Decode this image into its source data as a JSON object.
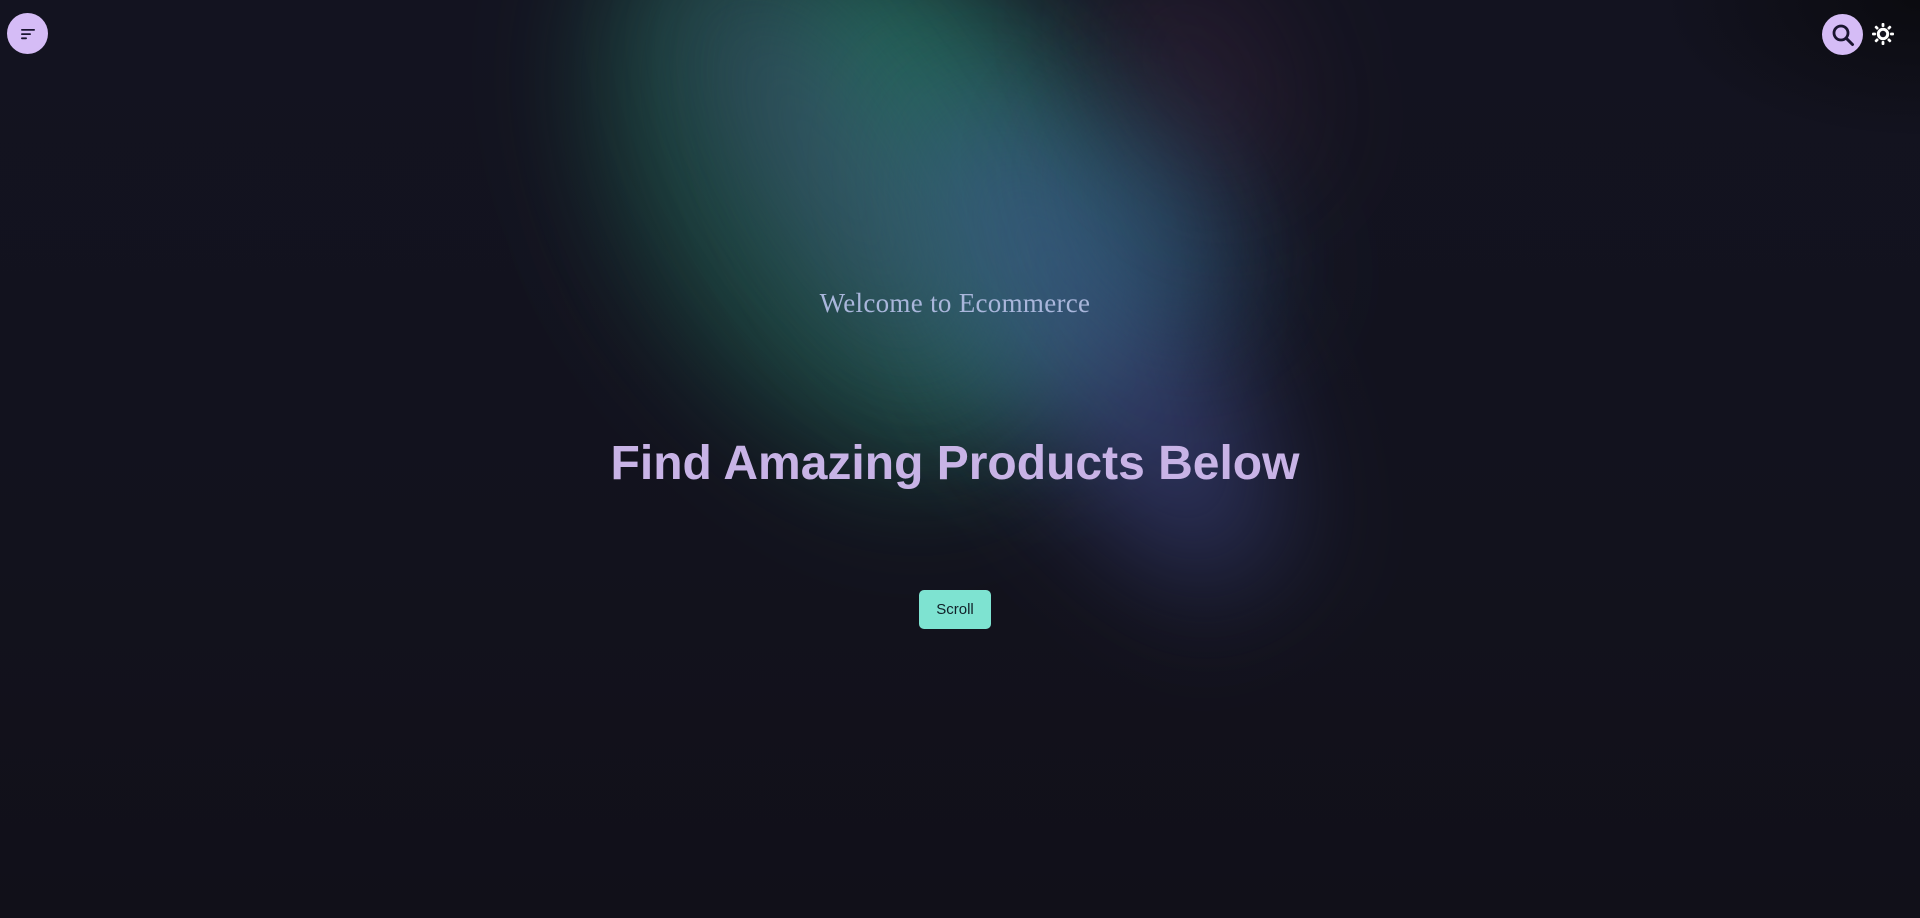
{
  "header": {
    "menu_icon": "menu-lines-icon",
    "search_icon": "search-icon",
    "theme_icon": "sun-icon"
  },
  "hero": {
    "welcome_text": "Welcome to Ecommerce",
    "headline": "Find Amazing Products Below",
    "scroll_label": "Scroll"
  },
  "colors": {
    "background": "#13131f",
    "button_lavender": "#d5bcf6",
    "headline": "#c8b3e6",
    "welcome": "#a9b6db",
    "scroll_button": "#7ee3d1"
  }
}
